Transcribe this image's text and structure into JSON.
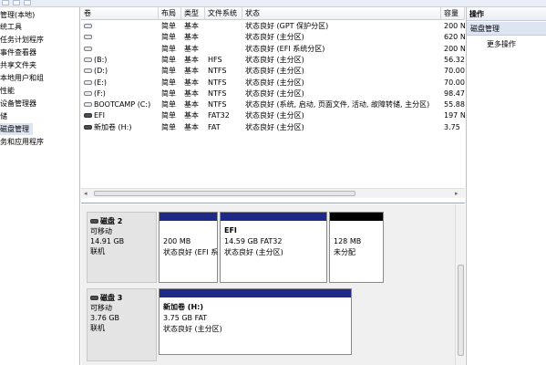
{
  "nav": {
    "items": [
      {
        "label": "管理(本地)",
        "selected": false
      },
      {
        "label": "统工具",
        "selected": false
      },
      {
        "label": "任务计划程序",
        "selected": false
      },
      {
        "label": "事件查看器",
        "selected": false
      },
      {
        "label": "共享文件夹",
        "selected": false
      },
      {
        "label": "本地用户和组",
        "selected": false
      },
      {
        "label": "性能",
        "selected": false
      },
      {
        "label": "设备管理器",
        "selected": false
      },
      {
        "label": "储",
        "selected": false
      },
      {
        "label": "磁盘管理",
        "selected": true
      },
      {
        "label": "务和应用程序",
        "selected": false
      }
    ]
  },
  "table": {
    "columns": [
      "卷",
      "布局",
      "类型",
      "文件系统",
      "状态",
      "容量"
    ],
    "rows": [
      {
        "vol": "",
        "icon": "light",
        "layout": "简单",
        "type": "基本",
        "fs": "",
        "status": "状态良好 (GPT 保护分区)",
        "cap": "200 N"
      },
      {
        "vol": "",
        "icon": "light",
        "layout": "简单",
        "type": "基本",
        "fs": "",
        "status": "状态良好 (主分区)",
        "cap": "620 N"
      },
      {
        "vol": "",
        "icon": "light",
        "layout": "简单",
        "type": "基本",
        "fs": "",
        "status": "状态良好 (EFI 系统分区)",
        "cap": "200 N"
      },
      {
        "vol": "(B:)",
        "icon": "light",
        "layout": "简单",
        "type": "基本",
        "fs": "HFS",
        "status": "状态良好 (主分区)",
        "cap": "56.32"
      },
      {
        "vol": "(D:)",
        "icon": "light",
        "layout": "简单",
        "type": "基本",
        "fs": "NTFS",
        "status": "状态良好 (主分区)",
        "cap": "70.00"
      },
      {
        "vol": "(E:)",
        "icon": "light",
        "layout": "简单",
        "type": "基本",
        "fs": "NTFS",
        "status": "状态良好 (主分区)",
        "cap": "70.00"
      },
      {
        "vol": "(F:)",
        "icon": "light",
        "layout": "简单",
        "type": "基本",
        "fs": "NTFS",
        "status": "状态良好 (主分区)",
        "cap": "98.47"
      },
      {
        "vol": "BOOTCAMP (C:)",
        "icon": "light",
        "layout": "简单",
        "type": "基本",
        "fs": "NTFS",
        "status": "状态良好 (系统, 启动, 页面文件, 活动, 故障转储, 主分区)",
        "cap": "55.88"
      },
      {
        "vol": "EFI",
        "icon": "dark",
        "layout": "简单",
        "type": "基本",
        "fs": "FAT32",
        "status": "状态良好 (主分区)",
        "cap": "197 N"
      },
      {
        "vol": "新加卷 (H:)",
        "icon": "dark",
        "layout": "简单",
        "type": "基本",
        "fs": "FAT",
        "status": "状态良好 (主分区)",
        "cap": "3.75"
      }
    ]
  },
  "disks": [
    {
      "name": "磁盘 2",
      "kind": "可移动",
      "size": "14.91 GB",
      "state": "联机",
      "partitions": [
        {
          "title": "",
          "size": "200 MB",
          "status": "状态良好 (EFI 系",
          "bar": "blue"
        },
        {
          "title": "EFI",
          "size": "14.59 GB FAT32",
          "status": "状态良好 (主分区)",
          "bar": "blue"
        },
        {
          "title": "",
          "size": "128 MB",
          "status": "未分配",
          "bar": "black"
        }
      ]
    },
    {
      "name": "磁盘 3",
      "kind": "可移动",
      "size": "3.76 GB",
      "state": "联机",
      "partitions": [
        {
          "title": "新加卷 (H:)",
          "size": "3.75 GB FAT",
          "status": "状态良好 (主分区)",
          "bar": "blue"
        }
      ]
    }
  ],
  "actions": {
    "header": "操作",
    "section": "磁盘管理",
    "more": "更多操作"
  },
  "colors": {
    "primary_bar": "#1d2a8a",
    "unallocated_bar": "#000000",
    "selection": "#dde5f2"
  }
}
